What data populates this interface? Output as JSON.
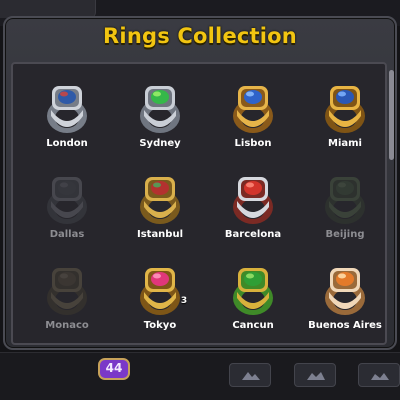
{
  "collection": {
    "title": "Rings Collection",
    "rings": [
      {
        "name": "London",
        "locked": false,
        "count": "",
        "band": "#cfd3da",
        "band_dark": "#777d88",
        "stone": "#2f5aa8",
        "stone_light": "#d0453d"
      },
      {
        "name": "Sydney",
        "locked": false,
        "count": "",
        "band": "#c9ced6",
        "band_dark": "#6f7580",
        "stone": "#35b84a",
        "stone_light": "#9ef06a"
      },
      {
        "name": "Lisbon",
        "locked": false,
        "count": "",
        "band": "#e6b449",
        "band_dark": "#8a5a1a",
        "stone": "#2f63c9",
        "stone_light": "#8fc0ff"
      },
      {
        "name": "Miami",
        "locked": false,
        "count": "",
        "band": "#e8b443",
        "band_dark": "#7f5415",
        "stone": "#2a57b5",
        "stone_light": "#7fb3ff"
      },
      {
        "name": "Dallas",
        "locked": true,
        "count": "",
        "band": "#9b9ea6",
        "band_dark": "#55585f",
        "stone": "#5b5f68",
        "stone_light": "#8d9199"
      },
      {
        "name": "Istanbul",
        "locked": false,
        "count": "",
        "band": "#d9b04c",
        "band_dark": "#7a5a1d",
        "stone": "#b3312f",
        "stone_light": "#4aa85a"
      },
      {
        "name": "Barcelona",
        "locked": false,
        "count": "",
        "band": "#d6d8de",
        "band_dark": "#7b2a24",
        "stone": "#d2342b",
        "stone_light": "#ff8b7a"
      },
      {
        "name": "Beijing",
        "locked": true,
        "count": "",
        "band": "#6c8c5b",
        "band_dark": "#3d4e35",
        "stone": "#4f7047",
        "stone_light": "#7f9c6f"
      },
      {
        "name": "Monaco",
        "locked": true,
        "count": "",
        "band": "#9a8a62",
        "band_dark": "#554b33",
        "stone": "#6f6244",
        "stone_light": "#a39474"
      },
      {
        "name": "Tokyo",
        "locked": false,
        "count": "3",
        "band": "#e1b648",
        "band_dark": "#7e5617",
        "stone": "#e0377a",
        "stone_light": "#ff9bc2"
      },
      {
        "name": "Cancun",
        "locked": false,
        "count": "",
        "band": "#d8b13c",
        "band_dark": "#3f8a28",
        "stone": "#2f9e35",
        "stone_light": "#9be36a"
      },
      {
        "name": "Buenos Aires",
        "locked": false,
        "count": "",
        "band": "#f0d7b8",
        "band_dark": "#9a6a3a",
        "stone": "#e37a2a",
        "stone_light": "#ffe2b0"
      }
    ]
  },
  "footer": {
    "level": "44"
  }
}
